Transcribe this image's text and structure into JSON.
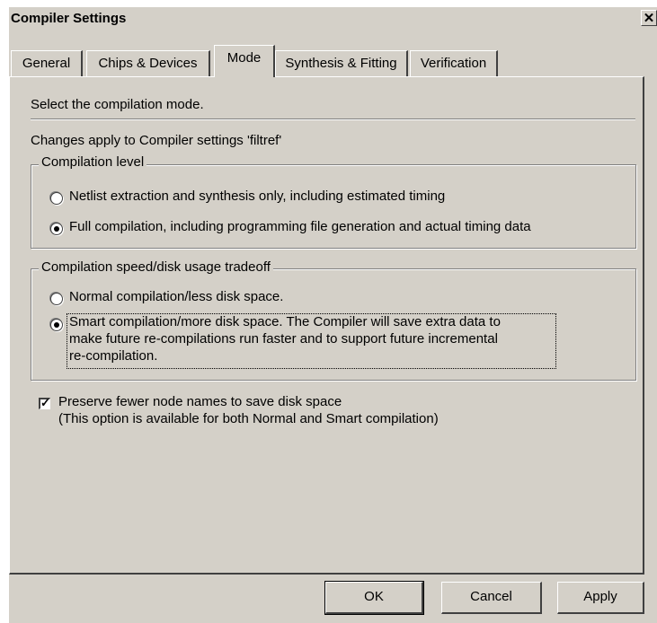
{
  "dialog": {
    "title": "Compiler Settings",
    "close_glyph": "✕"
  },
  "tabs": [
    {
      "label": "General"
    },
    {
      "label": "Chips & Devices"
    },
    {
      "label": "Mode",
      "active": true
    },
    {
      "label": "Synthesis & Fitting"
    },
    {
      "label": "Verification"
    }
  ],
  "mode": {
    "intro": "Select the compilation mode.",
    "changes_note": "Changes apply to Compiler settings 'filtref'",
    "compilation_level": {
      "legend": "Compilation level",
      "options": [
        {
          "label": "Netlist extraction and synthesis only, including estimated timing",
          "selected": false
        },
        {
          "label": "Full compilation, including programming file generation and actual timing data",
          "selected": true
        }
      ]
    },
    "speed_tradeoff": {
      "legend": "Compilation speed/disk usage tradeoff",
      "options": [
        {
          "label": "Normal compilation/less disk space.",
          "selected": false
        },
        {
          "lines": [
            "Smart compilation/more disk space.  The Compiler will save extra data to",
            "make future re-compilations run faster and to support future incremental",
            "re-compilation."
          ],
          "selected": true
        }
      ]
    },
    "preserve": {
      "label": "Preserve fewer node names to save disk space",
      "note": "(This option is available for both Normal and Smart compilation)",
      "checked": true,
      "check_glyph": "✓"
    }
  },
  "buttons": {
    "ok": "OK",
    "cancel": "Cancel",
    "apply": "Apply"
  }
}
